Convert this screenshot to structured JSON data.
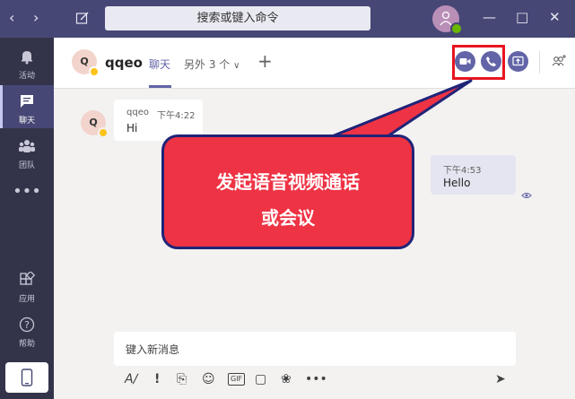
{
  "titlebar": {
    "back_icon": "chevron-left-icon",
    "forward_icon": "chevron-right-icon",
    "compose_icon": "compose-icon",
    "search_placeholder": "搜索或键入命令",
    "window_controls": [
      "minimize-icon",
      "maximize-icon",
      "close-icon"
    ]
  },
  "rail": {
    "items": [
      {
        "label": "活动",
        "icon": "bell-icon"
      },
      {
        "label": "聊天",
        "icon": "chat-icon"
      },
      {
        "label": "团队",
        "icon": "teams-icon"
      },
      {
        "label": "",
        "icon": "more-icon"
      },
      {
        "label": "应用",
        "icon": "apps-icon"
      },
      {
        "label": "帮助",
        "icon": "help-icon"
      }
    ],
    "device_icon": "mobile-icon"
  },
  "header": {
    "avatar_initial": "Q",
    "name": "qqeo",
    "tab": "聊天",
    "more_tabs": "另外 3 个",
    "add_tab": "+"
  },
  "messages": [
    {
      "sender": "qqeo",
      "time": "下午4:22",
      "text": "Hi",
      "direction": "incoming"
    },
    {
      "time": "下午4:53",
      "text": "Hello",
      "direction": "outgoing"
    }
  ],
  "callout": {
    "line1": "发起语音视频通话",
    "line2": "或会议",
    "color": "#ee3344",
    "border_color": "#1f2478"
  },
  "compose": {
    "placeholder": "键入新消息"
  },
  "colors": {
    "titlebar": "#464775",
    "rail": "#33344a",
    "accent": "#6264a7",
    "highlight": "#e8141f"
  }
}
